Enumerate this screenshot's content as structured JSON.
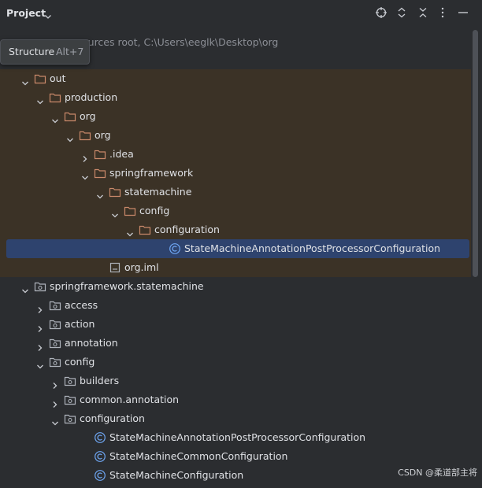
{
  "header": {
    "title": "Project",
    "icons": [
      "crosshair-icon",
      "expand-icon",
      "collapse-icon",
      "more-options-icon",
      "hide-icon"
    ]
  },
  "tooltip": {
    "title": "Structure",
    "shortcut": "Alt+7"
  },
  "root_row": {
    "text": "ources root,  C:\\Users\\eeglk\\Desktop\\org"
  },
  "tree": [
    {
      "label": "out",
      "depth": 1,
      "arrow": "down",
      "icon": "folder",
      "highlight": true
    },
    {
      "label": "production",
      "depth": 2,
      "arrow": "down",
      "icon": "folder",
      "highlight": true
    },
    {
      "label": "org",
      "depth": 3,
      "arrow": "down",
      "icon": "folder",
      "highlight": true
    },
    {
      "label": "org",
      "depth": 4,
      "arrow": "down",
      "icon": "folder",
      "highlight": true
    },
    {
      "label": ".idea",
      "depth": 5,
      "arrow": "right",
      "icon": "folder",
      "highlight": true
    },
    {
      "label": "springframework",
      "depth": 5,
      "arrow": "down",
      "icon": "folder",
      "highlight": true
    },
    {
      "label": "statemachine",
      "depth": 6,
      "arrow": "down",
      "icon": "folder",
      "highlight": true
    },
    {
      "label": "config",
      "depth": 7,
      "arrow": "down",
      "icon": "folder",
      "highlight": true
    },
    {
      "label": "configuration",
      "depth": 8,
      "arrow": "down",
      "icon": "folder",
      "highlight": true
    },
    {
      "label": "StateMachineAnnotationPostProcessorConfiguration",
      "depth": 10,
      "arrow": "none",
      "icon": "class",
      "highlight": true,
      "selected": true
    },
    {
      "label": "org.iml",
      "depth": 6,
      "arrow": "none",
      "icon": "file",
      "highlight": true
    },
    {
      "label": "springframework.statemachine",
      "depth": 1,
      "arrow": "down",
      "icon": "package",
      "highlight": false
    },
    {
      "label": "access",
      "depth": 2,
      "arrow": "right",
      "icon": "package",
      "highlight": false
    },
    {
      "label": "action",
      "depth": 2,
      "arrow": "right",
      "icon": "package",
      "highlight": false
    },
    {
      "label": "annotation",
      "depth": 2,
      "arrow": "right",
      "icon": "package",
      "highlight": false
    },
    {
      "label": "config",
      "depth": 2,
      "arrow": "down",
      "icon": "package",
      "highlight": false
    },
    {
      "label": "builders",
      "depth": 3,
      "arrow": "right",
      "icon": "package",
      "highlight": false
    },
    {
      "label": "common.annotation",
      "depth": 3,
      "arrow": "right",
      "icon": "package",
      "highlight": false
    },
    {
      "label": "configuration",
      "depth": 3,
      "arrow": "down",
      "icon": "package",
      "highlight": false
    },
    {
      "label": "StateMachineAnnotationPostProcessorConfiguration",
      "depth": 5,
      "arrow": "none",
      "icon": "class",
      "highlight": false
    },
    {
      "label": "StateMachineCommonConfiguration",
      "depth": 5,
      "arrow": "none",
      "icon": "class",
      "highlight": false
    },
    {
      "label": "StateMachineConfiguration",
      "depth": 5,
      "arrow": "none",
      "icon": "class",
      "highlight": false
    }
  ],
  "watermark": "CSDN @柔道部主将",
  "colors": {
    "background": "#2b2d30",
    "highlight_row": "#3b3226",
    "selection": "#2e436e",
    "folder_icon": "#c9896a",
    "class_icon": "#6ea6f2",
    "package_icon": "#aeb3bb"
  }
}
